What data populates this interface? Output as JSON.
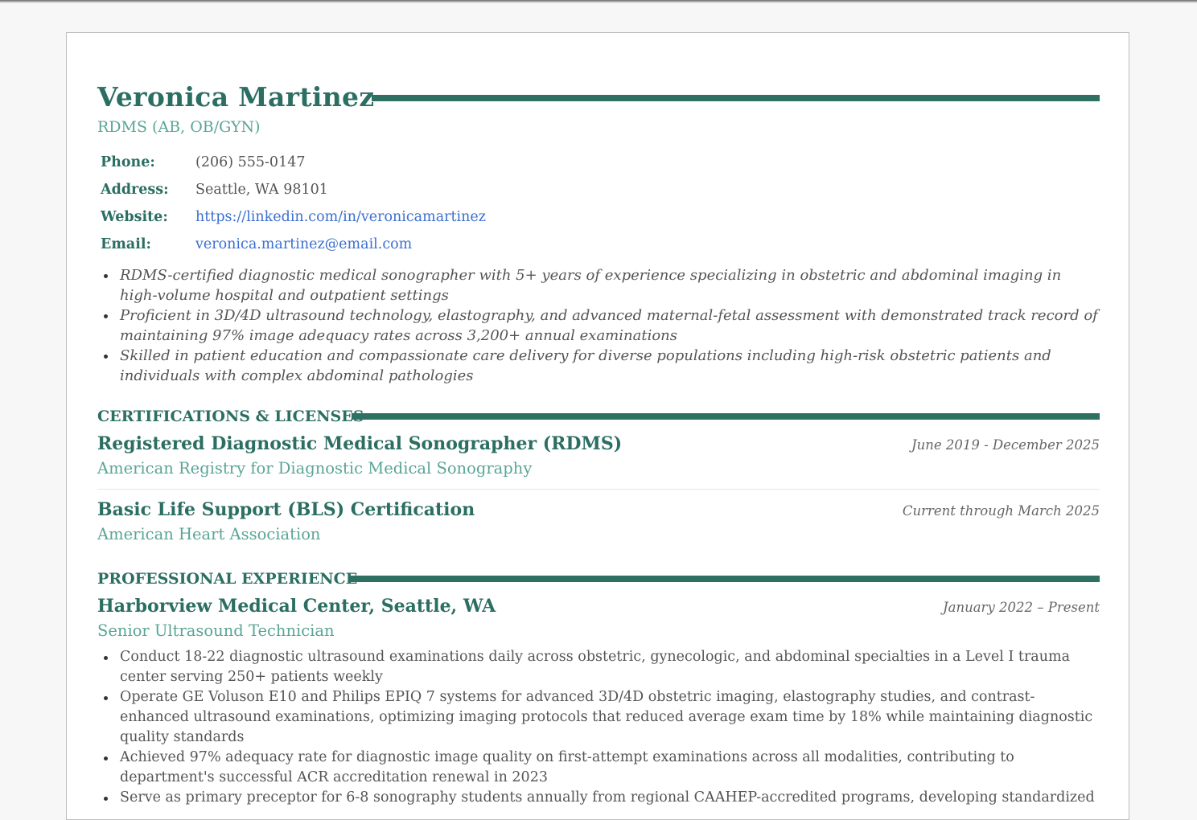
{
  "header": {
    "name": "Veronica Martinez",
    "credential": "RDMS (AB, OB/GYN)"
  },
  "contact": [
    {
      "label": "Phone:",
      "value": "(206) 555-0147"
    },
    {
      "label": "Address:",
      "value": "Seattle, WA 98101"
    },
    {
      "label": "Website:",
      "value": "https://linkedin.com/in/veronicamartinez"
    },
    {
      "label": "Email:",
      "value": "veronica.martinez@email.com"
    }
  ],
  "summary": [
    "RDMS-certified diagnostic medical sonographer with 5+ years of experience specializing in obstetric and abdominal imaging in high-volume hospital and outpatient settings",
    "Proficient in 3D/4D ultrasound technology, elastography, and advanced maternal-fetal assessment with demonstrated track record of maintaining 97% image adequacy rates across 3,200+ annual examinations",
    "Skilled in patient education and compassionate care delivery for diverse populations including high-risk obstetric patients and individuals with complex abdominal pathologies"
  ],
  "certifications": {
    "title": "CERTIFICATIONS & LICENSES",
    "items": [
      {
        "name": "Registered Diagnostic Medical Sonographer (RDMS)",
        "issuer": "American Registry for Diagnostic Medical Sonography",
        "date": "June 2019 - December 2025"
      },
      {
        "name": "Basic Life Support (BLS) Certification",
        "issuer": "American Heart Association",
        "date": "Current through March 2025"
      }
    ]
  },
  "experience": {
    "title": "PROFESSIONAL EXPERIENCE",
    "items": [
      {
        "employer": "Harborview Medical Center, Seattle, WA",
        "role": "Senior Ultrasound Technician",
        "date": "January 2022 – Present",
        "bullets": [
          "Conduct 18-22 diagnostic ultrasound examinations daily across obstetric, gynecologic, and abdominal specialties in a Level I trauma center serving 250+ patients weekly",
          "Operate GE Voluson E10 and Philips EPIQ 7 systems for advanced 3D/4D obstetric imaging, elastography studies, and contrast-enhanced ultrasound examinations, optimizing imaging protocols that reduced average exam time by 18% while maintaining diagnostic quality standards",
          "Achieved 97% adequacy rate for diagnostic image quality on first-attempt examinations across all modalities, contributing to department's successful ACR accreditation renewal in 2023",
          "Serve as primary preceptor for 6-8 sonography students annually from regional CAAHEP-accredited programs, developing standardized"
        ]
      }
    ]
  }
}
